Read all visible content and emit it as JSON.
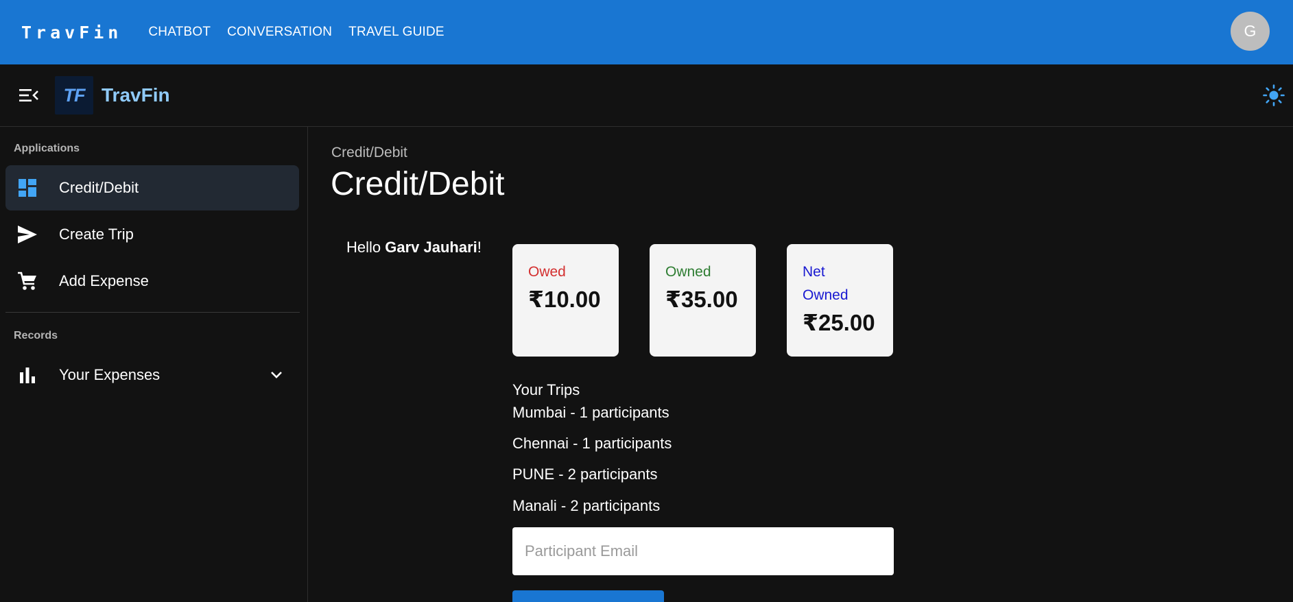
{
  "topbar": {
    "brand": "TravFin",
    "nav": [
      "CHATBOT",
      "CONVERSATION",
      "TRAVEL GUIDE"
    ],
    "avatar_initial": "G",
    "color": "#1976d2"
  },
  "subheader": {
    "logo_text": "TF",
    "app_name": "TravFin",
    "menu_icon": "menu-collapse-icon",
    "theme_icon": "sun-icon"
  },
  "sidebar": {
    "sections": [
      {
        "title": "Applications",
        "items": [
          {
            "label": "Credit/Debit",
            "icon": "dashboard-icon",
            "active": true
          },
          {
            "label": "Create Trip",
            "icon": "send-icon"
          },
          {
            "label": "Add Expense",
            "icon": "cart-icon"
          }
        ]
      },
      {
        "title": "Records",
        "items": [
          {
            "label": "Your Expenses",
            "icon": "bar-chart-icon",
            "expandable": true
          }
        ]
      }
    ]
  },
  "main": {
    "breadcrumb": "Credit/Debit",
    "title": "Credit/Debit",
    "greeting_prefix": "Hello ",
    "user_name": "Garv Jauhari",
    "greeting_suffix": "!",
    "cards": {
      "owed": {
        "label": "Owed",
        "value": "₹10.00",
        "color": "#d32f2f"
      },
      "owned": {
        "label": "Owned",
        "value": "₹35.00",
        "color": "#2e7d32"
      },
      "net": {
        "label": "Net Owned",
        "value": "₹25.00",
        "color": "#1919d1"
      }
    },
    "trips_title": "Your Trips",
    "trips": [
      "Mumbai - 1 participants",
      "Chennai - 1 participants",
      "PUNE - 2 participants",
      "Manali - 2 participants"
    ],
    "email_placeholder": "Participant Email"
  }
}
